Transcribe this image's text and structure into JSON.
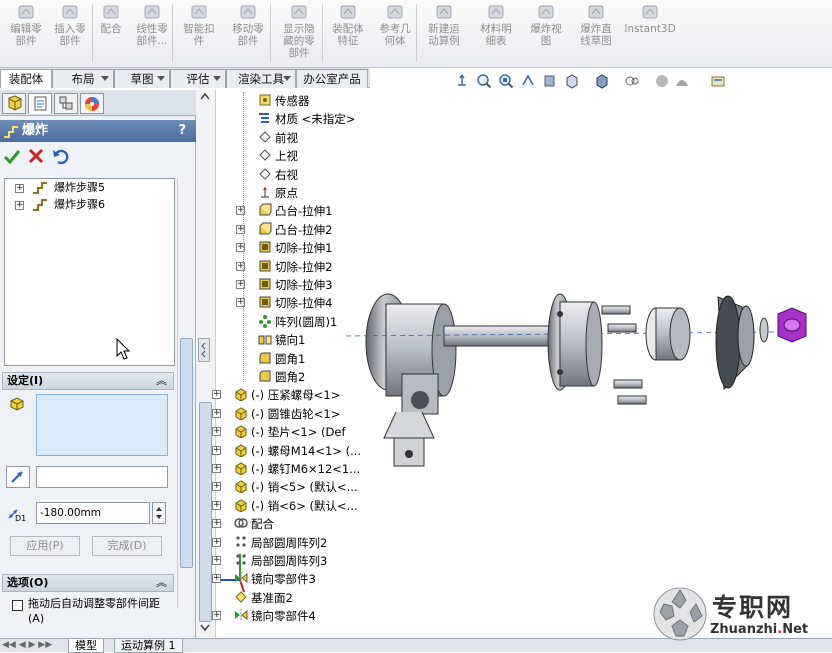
{
  "ribbon": {
    "buttons": [
      {
        "label": "编辑零\n部件",
        "icon": "edit-component-icon",
        "active": false
      },
      {
        "label": "插入零\n部件",
        "icon": "insert-component-icon",
        "active": false
      },
      {
        "label": "配合",
        "icon": "mate-icon",
        "active": false
      },
      {
        "label": "线性零\n部件...",
        "icon": "linear-pattern-icon",
        "active": false
      },
      {
        "label": "智能扣\n件",
        "icon": "smart-fastener-icon",
        "active": false
      },
      {
        "label": "移动零\n部件",
        "icon": "move-component-icon",
        "active": false
      },
      {
        "label": "显示隐\n藏的零\n部件",
        "icon": "show-hidden-icon",
        "active": false
      },
      {
        "label": "装配体\n特征",
        "icon": "assembly-feature-icon",
        "active": false
      },
      {
        "label": "参考几\n何体",
        "icon": "reference-geometry-icon",
        "active": false
      },
      {
        "label": "新建运\n动算例",
        "icon": "new-motion-study-icon",
        "active": false
      },
      {
        "label": "材料明\n细表",
        "icon": "bom-icon",
        "active": false
      },
      {
        "label": "爆炸视\n图",
        "icon": "exploded-view-icon",
        "active": false
      },
      {
        "label": "爆炸直\n线草图",
        "icon": "explode-line-sketch-icon",
        "active": false
      },
      {
        "label": "Instant3D",
        "icon": "instant3d-icon",
        "active": false
      }
    ]
  },
  "tabs": [
    "装配体",
    "布局",
    "草图",
    "评估",
    "渲染工具",
    "办公室产品"
  ],
  "property_manager": {
    "title": "爆炸",
    "help": "?",
    "steps": [
      "爆炸步骤5",
      "爆炸步骤6"
    ],
    "settings_title": "设定(I)",
    "distance_value": "-180.00mm",
    "distance_label": "D1",
    "apply_label": "应用(P)",
    "done_label": "完成(D)",
    "options_title": "选项(O)",
    "auto_space_label": "拖动后自动调整零部件间距(A)",
    "auto_space_checked": false
  },
  "tree": {
    "items": [
      {
        "label": "传感器",
        "icon": "sensor-icon",
        "indent": 1,
        "expander": ""
      },
      {
        "label": "材质 <未指定>",
        "icon": "material-icon",
        "indent": 1,
        "expander": ""
      },
      {
        "label": "前视",
        "icon": "plane-icon",
        "indent": 1,
        "expander": ""
      },
      {
        "label": "上视",
        "icon": "plane-icon",
        "indent": 1,
        "expander": ""
      },
      {
        "label": "右视",
        "icon": "plane-icon",
        "indent": 1,
        "expander": ""
      },
      {
        "label": "原点",
        "icon": "origin-icon",
        "indent": 1,
        "expander": ""
      },
      {
        "label": "凸台-拉伸1",
        "icon": "boss-extrude-icon",
        "indent": 1,
        "expander": "+"
      },
      {
        "label": "凸台-拉伸2",
        "icon": "boss-extrude-icon",
        "indent": 1,
        "expander": "+"
      },
      {
        "label": "切除-拉伸1",
        "icon": "cut-extrude-icon",
        "indent": 1,
        "expander": "+"
      },
      {
        "label": "切除-拉伸2",
        "icon": "cut-extrude-icon",
        "indent": 1,
        "expander": "+"
      },
      {
        "label": "切除-拉伸3",
        "icon": "cut-extrude-icon",
        "indent": 1,
        "expander": "+"
      },
      {
        "label": "切除-拉伸4",
        "icon": "cut-extrude-icon",
        "indent": 1,
        "expander": "+"
      },
      {
        "label": "阵列(圆周)1",
        "icon": "circular-pattern-icon",
        "indent": 1,
        "expander": ""
      },
      {
        "label": "镜向1",
        "icon": "mirror-icon",
        "indent": 1,
        "expander": ""
      },
      {
        "label": "圆角1",
        "icon": "fillet-icon",
        "indent": 1,
        "expander": ""
      },
      {
        "label": "圆角2",
        "icon": "fillet-icon",
        "indent": 1,
        "expander": ""
      },
      {
        "label": "(-) 压紧螺母<1>",
        "icon": "part-icon",
        "indent": 0,
        "expander": "+"
      },
      {
        "label": "(-) 圆锥齿轮<1>",
        "icon": "part-icon",
        "indent": 0,
        "expander": "+"
      },
      {
        "label": "(-) 垫片<1> (Def",
        "icon": "part-icon",
        "indent": 0,
        "expander": "+"
      },
      {
        "label": "(-) 螺母M14<1> (...",
        "icon": "part-icon",
        "indent": 0,
        "expander": "+"
      },
      {
        "label": "(-) 螺钉M6×12<1...",
        "icon": "part-icon",
        "indent": 0,
        "expander": "+"
      },
      {
        "label": "(-) 销<5> (默认<...",
        "icon": "part-icon",
        "indent": 0,
        "expander": "+"
      },
      {
        "label": "(-) 销<6> (默认<...",
        "icon": "part-icon",
        "indent": 0,
        "expander": "+"
      },
      {
        "label": "配合",
        "icon": "mates-folder-icon",
        "indent": 0,
        "expander": "+"
      },
      {
        "label": "局部圆周阵列2",
        "icon": "local-pattern-icon",
        "indent": 0,
        "expander": "+"
      },
      {
        "label": "局部圆周阵列3",
        "icon": "local-pattern-icon",
        "indent": 0,
        "expander": "+"
      },
      {
        "label": "镜向零部件3",
        "icon": "mirror-component-icon",
        "indent": 0,
        "expander": "+"
      },
      {
        "label": "基准面2",
        "icon": "plane-yellow-icon",
        "indent": 0,
        "expander": ""
      },
      {
        "label": "镜向零部件4",
        "icon": "mirror-component-icon",
        "indent": 0,
        "expander": "+"
      }
    ]
  },
  "bottom_tabs": [
    "模型",
    "运动算例 1"
  ],
  "watermark": {
    "title": "专职网",
    "url": "Zhuanzhi",
    "url_dot": ".",
    "url_tld": "Net"
  },
  "colors": {
    "accent": "#4b6d9e",
    "selection": "#d9ecfb",
    "nut": "#a431c9"
  }
}
